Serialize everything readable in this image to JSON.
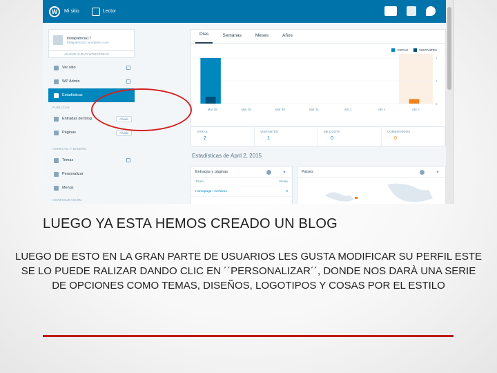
{
  "wp_bar": {
    "my_site_label": "Mi sitio",
    "reader_label": "Lector"
  },
  "sidebar": {
    "site_name": "lolitapatricia17",
    "site_url": "lolitapatricia17.wordpress.com",
    "add_site": "AÑADIR NUEVO WORDPRESS",
    "items": [
      {
        "label": "Ver sitio"
      },
      {
        "label": "WP Admin"
      },
      {
        "label": "Estadísticas"
      }
    ],
    "section_publish": "PUBLICAR",
    "publish_items": [
      {
        "label": "Entradas del blog",
        "action": "Añadir"
      },
      {
        "label": "Páginas",
        "action": "Añadir"
      }
    ],
    "section_design": "ASPECTO Y DISEÑO",
    "design_items": [
      {
        "label": "Temas"
      },
      {
        "label": "Personalizar"
      },
      {
        "label": "Menús"
      }
    ],
    "section_config": "CONFIGURACIÓN"
  },
  "stats": {
    "tabs": [
      "Días",
      "Semanas",
      "Meses",
      "Años"
    ],
    "legend": {
      "views": "VISTAS",
      "visitors": "VISITANTES"
    },
    "colors": {
      "views": "#0087be",
      "visitors": "#004e7a",
      "highlight": "#f0821e",
      "highlight_bg": "#fcf0e4"
    },
    "totals": [
      {
        "label": "VISTAS",
        "value": "2"
      },
      {
        "label": "VISITANTES",
        "value": "1"
      },
      {
        "label": "ME GUSTA",
        "value": "0"
      },
      {
        "label": "COMENTARIOS",
        "value": "0"
      }
    ],
    "stats_date": "Estadísticas de April 2, 2015",
    "posts_panel": {
      "title": "Entradas y páginas",
      "col_title": "Título",
      "col_views": "Vistas",
      "rows": [
        {
          "title": "Homepage / Archivos",
          "views": "2"
        }
      ]
    },
    "countries_panel": {
      "title": "Países"
    }
  },
  "chart_data": {
    "type": "bar",
    "categories": [
      "Mar 28",
      "Mar 29",
      "Mar 30",
      "Mar 31",
      "Abr 1",
      "Abr 1",
      "Abr 2"
    ],
    "series": [
      {
        "name": "VISTAS",
        "values": [
          2,
          0,
          0,
          0,
          0,
          0,
          0
        ]
      },
      {
        "name": "VISITANTES",
        "values": [
          0.3,
          0,
          0,
          0,
          0,
          0,
          0.2
        ]
      }
    ],
    "highlight_category_index": 6,
    "y_ticks": [
      "2",
      "1",
      "0"
    ],
    "ylim": [
      0,
      2
    ]
  },
  "slide": {
    "title": "LUEGO YA ESTA HEMOS CREADO UN BLOG",
    "body": "LUEGO DE ESTO EN LA GRAN PARTE DE USUARIOS LES GUSTA MODIFICAR SU PERFIL ESTE SE LO PUEDE RALIZAR DANDO CLIC EN ´´PERSONALIZAR´´, DONDE NOS DARÀ UNA SERIE DE OPCIONES COMO TEMAS, DISEÑOS, LOGOTIPOS Y COSAS POR EL ESTILO"
  }
}
